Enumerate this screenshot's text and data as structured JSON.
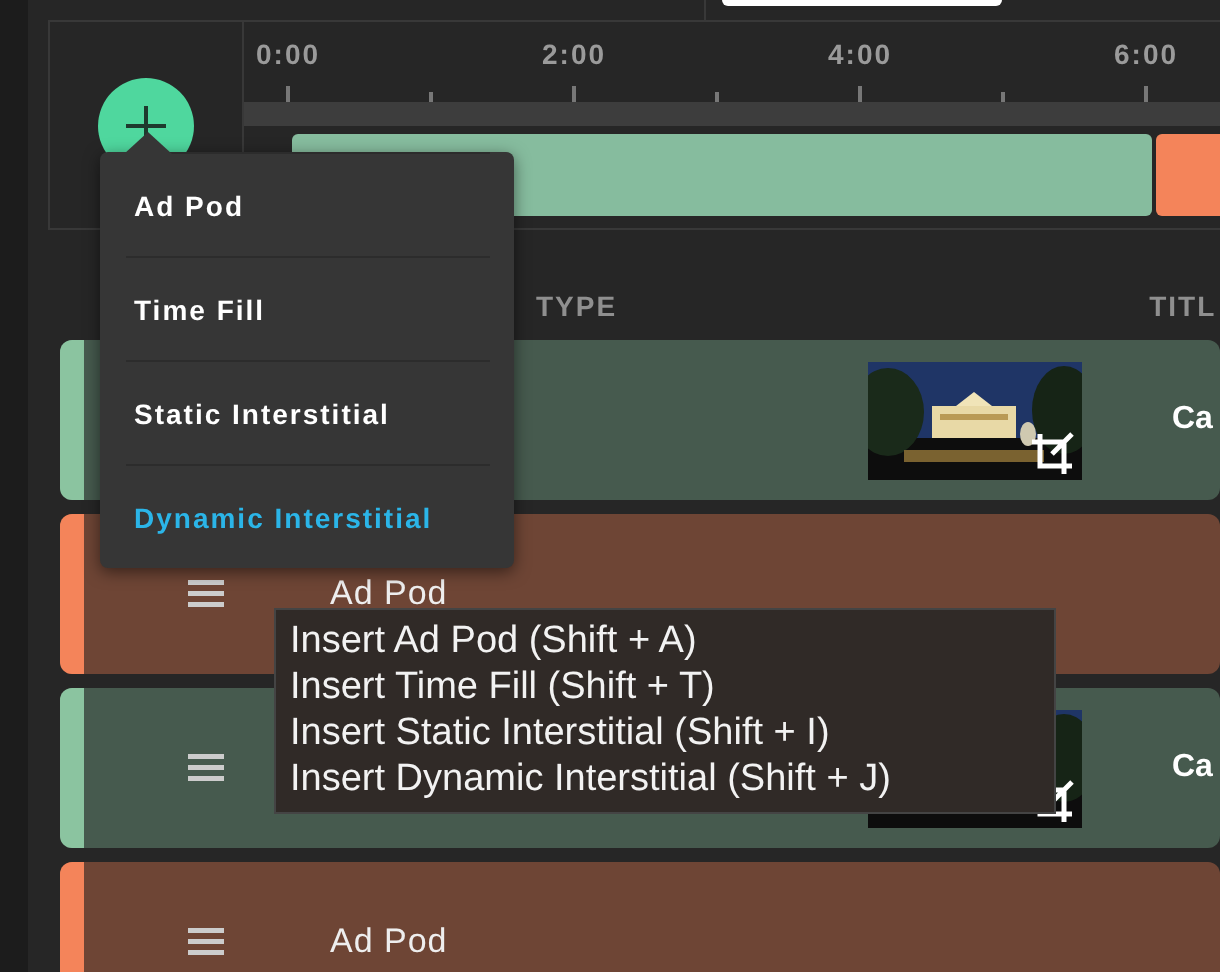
{
  "timeline": {
    "ruler_labels": [
      "0:00",
      "2:00",
      "4:00",
      "6:00"
    ],
    "segments": [
      {
        "kind": "content"
      },
      {
        "kind": "ad"
      }
    ]
  },
  "add_menu": {
    "items": [
      {
        "label": "Ad Pod",
        "selected": false
      },
      {
        "label": "Time Fill",
        "selected": false
      },
      {
        "label": "Static Interstitial",
        "selected": false
      },
      {
        "label": "Dynamic Interstitial",
        "selected": true
      }
    ]
  },
  "table": {
    "columns": [
      "TYPE",
      "TITL"
    ],
    "rows": [
      {
        "kind": "content",
        "drag_handle": false,
        "thumbnail": true,
        "title": "Ca"
      },
      {
        "kind": "ad",
        "drag_handle": true,
        "type": "Ad Pod"
      },
      {
        "kind": "content",
        "drag_handle": true,
        "thumbnail": true,
        "title": "Ca"
      },
      {
        "kind": "ad",
        "drag_handle": true,
        "type": "Ad Pod"
      }
    ]
  },
  "tooltip": {
    "lines": [
      "Insert Ad Pod (Shift + A)",
      "Insert Time Fill (Shift + T)",
      "Insert Static Interstitial (Shift + I)",
      "Insert Dynamic Interstitial (Shift + J)"
    ]
  }
}
